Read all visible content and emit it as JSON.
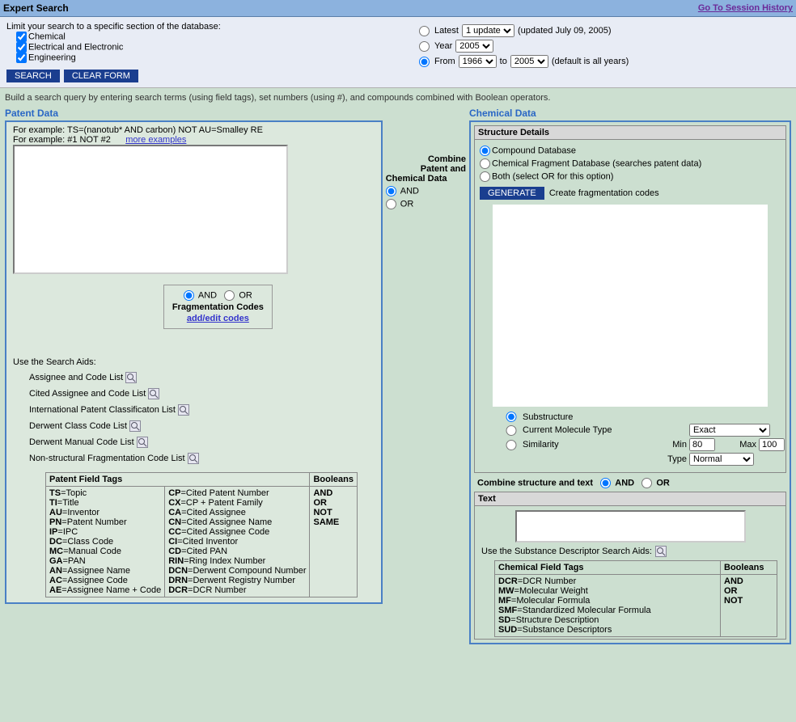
{
  "header": {
    "title": "Expert Search",
    "history": "Go To Session History"
  },
  "limit": {
    "instruction": "Limit your search to a specific section of the database:",
    "checks": [
      {
        "label": "Chemical",
        "checked": true
      },
      {
        "label": "Electrical and Electronic",
        "checked": true
      },
      {
        "label": "Engineering",
        "checked": true
      }
    ],
    "buttons": {
      "search": "SEARCH",
      "clear": "CLEAR FORM"
    },
    "update": {
      "latest": "Latest",
      "latest_select": "1 update",
      "updated": "(updated July 09, 2005)",
      "year": "Year",
      "year_select": "2005",
      "from": "From",
      "from_select": "1966",
      "to": "to",
      "to_select": "2005",
      "defaultnote": "(default is all years)"
    }
  },
  "instructions": "Build a search query by entering search terms (using field tags), set numbers (using #), and compounds combined with Boolean operators.",
  "patent": {
    "label": "Patent Data",
    "ex1": "For example: TS=(nanotub* AND carbon) NOT AU=Smalley RE",
    "ex2a": "For example: #1 NOT #2",
    "ex2b": "more examples",
    "frag": {
      "and": "AND",
      "or": "OR",
      "title": "Fragmentation Codes",
      "addedit": "add/edit codes"
    },
    "aids_title": "Use the Search Aids:",
    "aids": [
      "Assignee and Code List",
      "Cited Assignee and Code List",
      "International Patent Classificaton List",
      "Derwent Class Code List",
      "Derwent Manual Code List",
      "Non-structural Fragmentation Code List"
    ],
    "table": {
      "h1": "Patent Field Tags",
      "h2": "Booleans",
      "col1": [
        [
          "TS",
          "Topic"
        ],
        [
          "TI",
          "Title"
        ],
        [
          "AU",
          "Inventor"
        ],
        [
          "PN",
          "Patent Number"
        ],
        [
          "IP",
          "IPC"
        ],
        [
          "DC",
          "Class Code"
        ],
        [
          "MC",
          "Manual Code"
        ],
        [
          "GA",
          "PAN"
        ],
        [
          "AN",
          "Assignee Name"
        ],
        [
          "AC",
          "Assignee Code"
        ],
        [
          "AE",
          "Assignee Name + Code"
        ]
      ],
      "col2": [
        [
          "CP",
          "Cited Patent Number"
        ],
        [
          "CX",
          "CP + Patent Family"
        ],
        [
          "CA",
          "Cited Assignee"
        ],
        [
          "CN",
          "Cited Assignee Name"
        ],
        [
          "CC",
          "Cited Assignee Code"
        ],
        [
          "CI",
          "Cited Inventor"
        ],
        [
          "CD",
          "Cited PAN"
        ],
        [
          "RIN",
          "Ring Index Number"
        ],
        [
          "DCN",
          "Derwent Compound Number"
        ],
        [
          "DRN",
          "Derwent Registry Number"
        ],
        [
          "DCR",
          "DCR Number"
        ]
      ],
      "booleans": [
        "AND",
        "OR",
        "NOT",
        "SAME"
      ]
    }
  },
  "combine": {
    "title1": "Combine",
    "title2": "Patent and",
    "title3": "Chemical Data",
    "and": "AND",
    "or": "OR"
  },
  "chemical": {
    "label": "Chemical Data",
    "struct_head": "Structure Details",
    "radios": [
      "Compound Database",
      "Chemical Fragment Database (searches patent data)",
      "Both (select OR for this option)"
    ],
    "generate": "GENERATE",
    "generate_desc": "Create fragmentation codes",
    "searchmode": {
      "sub": "Substructure",
      "cur": "Current Molecule Type",
      "sim": "Similarity",
      "exact": "Exact",
      "min": "Min",
      "max": "Max",
      "minv": "80",
      "maxv": "100",
      "type": "Type",
      "typev": "Normal"
    },
    "combine2": "Combine structure and text",
    "and": "AND",
    "or": "OR",
    "text_head": "Text",
    "desc_aids": "Use the Substance Descriptor Search Aids:",
    "chemtbl": {
      "h1": "Chemical Field Tags",
      "h2": "Booleans",
      "rows": [
        [
          "DCR",
          "DCR Number"
        ],
        [
          "MW",
          "Molecular Weight"
        ],
        [
          "MF",
          "Molecular Formula"
        ],
        [
          "SMF",
          "Standardized Molecular Formula"
        ],
        [
          "SD",
          "Structure Description"
        ],
        [
          "SUD",
          "Substance Descriptors"
        ]
      ],
      "booleans": [
        "AND",
        "OR",
        "NOT"
      ]
    }
  }
}
